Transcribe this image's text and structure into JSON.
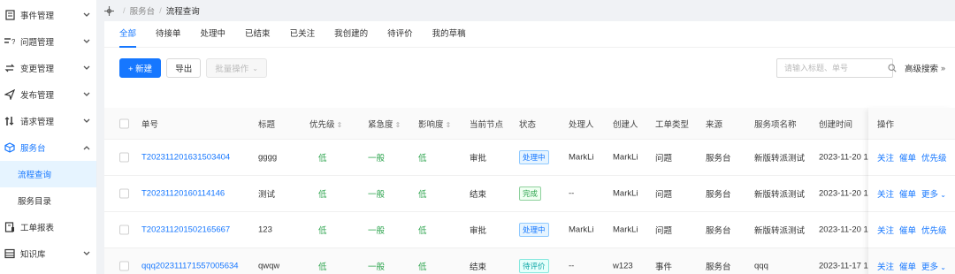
{
  "sidebar": {
    "items": [
      {
        "label": "事件管理",
        "icon": "document-icon",
        "chevron": "down"
      },
      {
        "label": "问题管理",
        "icon": "question-list-icon",
        "chevron": "down"
      },
      {
        "label": "变更管理",
        "icon": "swap-icon",
        "chevron": "down"
      },
      {
        "label": "发布管理",
        "icon": "send-icon",
        "chevron": "down"
      },
      {
        "label": "请求管理",
        "icon": "request-icon",
        "chevron": "down"
      },
      {
        "label": "服务台",
        "icon": "cube-icon",
        "chevron": "up",
        "active": true
      },
      {
        "label": "工单报表",
        "icon": "report-icon",
        "chevron": ""
      },
      {
        "label": "知识库",
        "icon": "book-icon",
        "chevron": "down"
      }
    ],
    "sub_items": [
      {
        "label": "流程查询",
        "selected": true
      },
      {
        "label": "服务目录",
        "selected": false
      }
    ]
  },
  "breadcrumb": {
    "parent": "服务台",
    "current": "流程查询",
    "separator": "/"
  },
  "tabs": [
    "全部",
    "待接单",
    "处理中",
    "已结束",
    "已关注",
    "我创建的",
    "待评价",
    "我的草稿"
  ],
  "active_tab": 0,
  "toolbar": {
    "new_label": "+ 新建",
    "export_label": "导出",
    "batch_label": "批量操作",
    "search_placeholder": "请输入标题、单号",
    "advanced_search": "高级搜索"
  },
  "table": {
    "headers": {
      "id": "单号",
      "title": "标题",
      "priority": "优先级",
      "urgency": "紧急度",
      "impact": "影响度",
      "node": "当前节点",
      "status": "状态",
      "handler": "处理人",
      "creator": "创建人",
      "type": "工单类型",
      "source": "来源",
      "service": "服务项名称",
      "created": "创建时间",
      "ops": "操作"
    },
    "rows": [
      {
        "id": "T202311201631503404",
        "title": "gggg",
        "priority": "低",
        "urgency": "一般",
        "impact": "低",
        "node": "审批",
        "status": "处理中",
        "status_kind": "processing",
        "handler": "MarkLi",
        "creator": "MarkLi",
        "type": "问题",
        "source": "服务台",
        "service": "新版转派测试",
        "created": "2023-11-20 16:3",
        "ops": [
          "关注",
          "催单",
          "优先级"
        ]
      },
      {
        "id": "T20231120160114146",
        "title": "测试",
        "priority": "低",
        "urgency": "一般",
        "impact": "低",
        "node": "结束",
        "status": "完成",
        "status_kind": "done",
        "handler": "--",
        "creator": "MarkLi",
        "type": "问题",
        "source": "服务台",
        "service": "新版转派测试",
        "created": "2023-11-20 16:0",
        "ops": [
          "关注",
          "催单",
          "更多"
        ]
      },
      {
        "id": "T202311201502165667",
        "title": "123",
        "priority": "低",
        "urgency": "一般",
        "impact": "低",
        "node": "审批",
        "status": "处理中",
        "status_kind": "processing",
        "handler": "MarkLi",
        "creator": "MarkLi",
        "type": "问题",
        "source": "服务台",
        "service": "新版转派测试",
        "created": "2023-11-20 15:0",
        "ops": [
          "关注",
          "催单",
          "优先级"
        ]
      },
      {
        "id": "qqq202311171557005634",
        "title": "qwqw",
        "priority": "低",
        "urgency": "一般",
        "impact": "低",
        "node": "结束",
        "status": "待评价",
        "status_kind": "pending",
        "handler": "--",
        "creator": "w123",
        "type": "事件",
        "source": "服务台",
        "service": "qqq",
        "created": "2023-11-17 15:5",
        "ops": [
          "关注",
          "催单",
          "更多"
        ]
      }
    ]
  },
  "colors": {
    "accent": "#1677ff",
    "low": "#2da44e",
    "sidebar_selected_bg": "#e6f4ff"
  }
}
